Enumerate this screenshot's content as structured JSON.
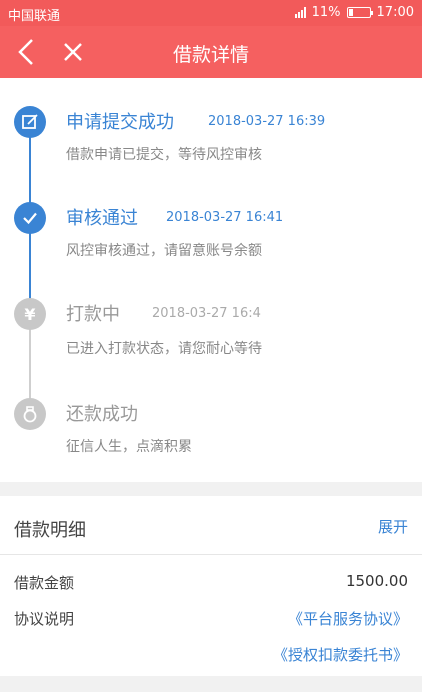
{
  "status_bar": {
    "carrier": "中国联通",
    "battery": "11%",
    "time": "17:00"
  },
  "header": {
    "title": "借款详情"
  },
  "timeline": [
    {
      "title": "申请提交成功",
      "time": "2018-03-27 16:39",
      "desc": "借款申请已提交，等待风控审核",
      "state": "done",
      "icon": "edit-icon"
    },
    {
      "title": "审核通过",
      "time": "2018-03-27 16:41",
      "desc": "风控审核通过，请留意账号余额",
      "state": "done",
      "icon": "check-icon"
    },
    {
      "title": "打款中",
      "time": "2018-03-27 16:4",
      "desc": "已进入打款状态，请您耐心等待",
      "state": "pending",
      "icon": "yuan-icon"
    },
    {
      "title": "还款成功",
      "time": "",
      "desc": "征信人生，点滴积累",
      "state": "pending",
      "icon": "money-bag-icon"
    }
  ],
  "details": {
    "heading": "借款明细",
    "expand": "展开",
    "amount_label": "借款金额",
    "amount_value": "1500.00",
    "agreement_label": "协议说明",
    "agreement_link_1": "《平台服务协议》",
    "agreement_link_2": "《授权扣款委托书》"
  },
  "colors": {
    "brand": "#f56060",
    "accent": "#3a84d4",
    "inactive": "#c8c8c8"
  }
}
